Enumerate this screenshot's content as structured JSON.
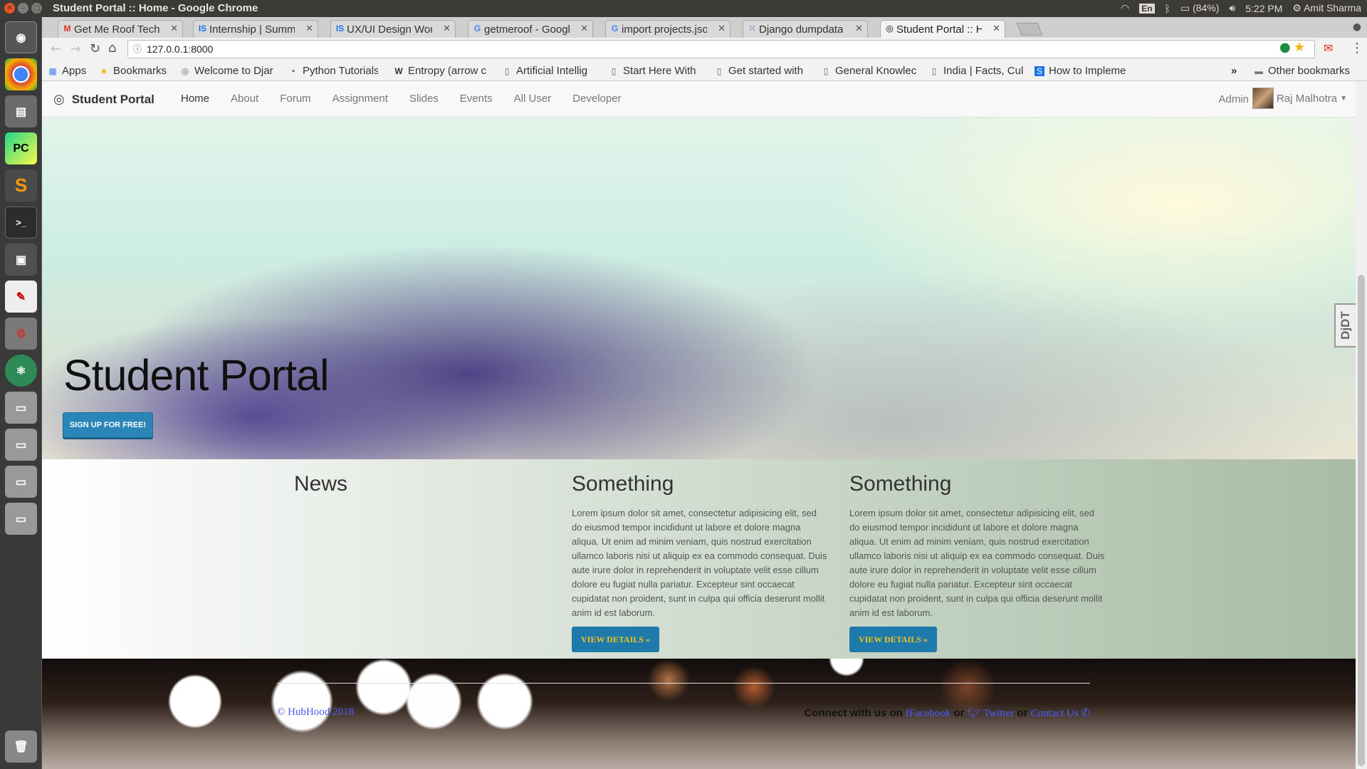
{
  "os_topbar": {
    "window_title": "Student Portal :: Home - Google Chrome",
    "keyboard_layout": "En",
    "battery": "(84%)",
    "time": "5:22 PM",
    "user": "Amit Sharma"
  },
  "launcher": {
    "icons": [
      "dash-icon",
      "chrome-icon",
      "files-icon",
      "pycharm-icon",
      "sublime-icon",
      "terminal-icon",
      "window-icon",
      "text-editor-icon",
      "settings-icon",
      "atom-icon",
      "drive-icon",
      "drive-icon",
      "drive-icon",
      "drive-icon",
      "trash-icon"
    ]
  },
  "tabs": [
    {
      "label": "Get Me Roof Tech A",
      "icon": "gmail-icon"
    },
    {
      "label": "Internship | Summe",
      "icon": "internshala-icon"
    },
    {
      "label": "UX/UI Design Work",
      "icon": "internshala-icon"
    },
    {
      "label": "getmeroof - Google",
      "icon": "google-icon"
    },
    {
      "label": "import projects.jso",
      "icon": "google-icon"
    },
    {
      "label": "Django dumpdata",
      "icon": "dots-icon"
    },
    {
      "label": "Student Portal :: Hc",
      "icon": "globe-icon",
      "active": true
    }
  ],
  "address_bar": {
    "url": "127.0.0.1:8000"
  },
  "bookmarks": {
    "items": [
      {
        "label": "Apps",
        "icon": "apps-icon"
      },
      {
        "label": "Bookmarks",
        "icon": "star-icon"
      },
      {
        "label": "Welcome to Djar",
        "icon": "globe-icon"
      },
      {
        "label": "Python Tutorials",
        "icon": "python-icon"
      },
      {
        "label": "Entropy (arrow c",
        "icon": "wikipedia-icon"
      },
      {
        "label": "Artificial Intellig",
        "icon": "page-icon"
      },
      {
        "label": "Start Here With",
        "icon": "page-icon"
      },
      {
        "label": "Get started with",
        "icon": "page-icon"
      },
      {
        "label": "General Knowlec",
        "icon": "page-icon"
      },
      {
        "label": "India | Facts, Cul",
        "icon": "page-icon"
      },
      {
        "label": "How to Impleme",
        "icon": "s-icon"
      }
    ],
    "overflow": "»",
    "other": "Other bookmarks"
  },
  "navbar": {
    "brand": "Student Portal",
    "links": [
      "Home",
      "About",
      "Forum",
      "Assignment",
      "Slides",
      "Events",
      "All User",
      "Developer"
    ],
    "admin": "Admin",
    "user": "Raj Malhotra"
  },
  "hero": {
    "title": "Student Portal",
    "signup": "SIGN UP FOR FREE!"
  },
  "content": {
    "news_title": "News",
    "columns": [
      {
        "title": "Something",
        "body": "Lorem ipsum dolor sit amet, consectetur adipisicing elit, sed do eiusmod tempor incididunt ut labore et dolore magna aliqua. Ut enim ad minim veniam, quis nostrud exercitation ullamco laboris nisi ut aliquip ex ea commodo consequat. Duis aute irure dolor in reprehenderit in voluptate velit esse cillum dolore eu fugiat nulla pariatur. Excepteur sint occaecat cupidatat non proident, sunt in culpa qui officia deserunt mollit anim id est laborum.",
        "button": "VIEW DETAILS »"
      },
      {
        "title": "Something",
        "body": "Lorem ipsum dolor sit amet, consectetur adipisicing elit, sed do eiusmod tempor incididunt ut labore et dolore magna aliqua. Ut enim ad minim veniam, quis nostrud exercitation ullamco laboris nisi ut aliquip ex ea commodo consequat. Duis aute irure dolor in reprehenderit in voluptate velit esse cillum dolore eu fugiat nulla pariatur. Excepteur sint occaecat cupidatat non proident, sunt in culpa qui officia deserunt mollit anim id est laborum.",
        "button": "VIEW DETAILS »"
      }
    ]
  },
  "footer": {
    "copyright": "© HubHood 2018",
    "connect": "Connect with us on",
    "facebook": "Facebook",
    "or1": "or",
    "twitter": "Twitter",
    "or2": "or",
    "contact": "Contact Us"
  },
  "debug_toolbar": {
    "label": "DjDT"
  }
}
